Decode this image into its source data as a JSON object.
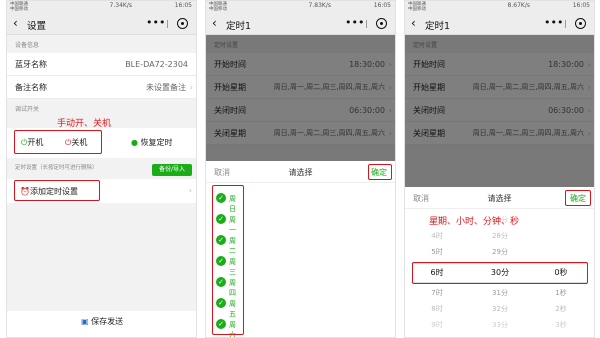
{
  "phone1": {
    "status": {
      "carrier1": "中国联通",
      "carrier2": "中国移动",
      "speed": "7.34K/s",
      "time": "16:05"
    },
    "title": "设置",
    "section_device": "设备信息",
    "rows": [
      {
        "label": "蓝牙名称",
        "value": "BLE-DA72-2304"
      },
      {
        "label": "备注名称",
        "value": "未设置备注"
      }
    ],
    "section_debug": "调试开关",
    "annotation": "手动开、关机",
    "btn_on": "开机",
    "btn_off": "关机",
    "btn_restore": "恢复定时",
    "section_timer": "定时设置（长按定时可进行删除）",
    "btn_backup": "备份/导入",
    "btn_add": "添加定时设置",
    "btn_save": "保存发送"
  },
  "phone2": {
    "status": {
      "carrier1": "中国联通",
      "carrier2": "中国移动",
      "speed": "7.83K/s",
      "time": "16:05"
    },
    "title": "定时1",
    "section": "定时设置",
    "rows": [
      {
        "label": "开始时间",
        "value": "18:30:00"
      },
      {
        "label": "开始星期",
        "value": "周日,周一,周二,周三,周四,周五,周六"
      },
      {
        "label": "关闭时间",
        "value": "06:30:00"
      },
      {
        "label": "关闭星期",
        "value": "周日,周一,周二,周三,周四,周五,周六"
      }
    ],
    "cancel": "取消",
    "prompt": "请选择",
    "ok": "确定",
    "days": [
      "周日",
      "周一",
      "周二",
      "周三",
      "周四",
      "周五",
      "周六"
    ]
  },
  "phone3": {
    "status": {
      "carrier1": "中国联通",
      "carrier2": "中国移动",
      "speed": "8.67K/s",
      "time": "16:05"
    },
    "title": "定时1",
    "section": "定时设置",
    "rows": [
      {
        "label": "开始时间",
        "value": "18:30:00"
      },
      {
        "label": "开始星期",
        "value": "周日,周一,周二,周三,周四,周五,周六"
      },
      {
        "label": "关闭时间",
        "value": "06:30:00"
      },
      {
        "label": "关闭星期",
        "value": "周日,周一,周二,周三,周四,周五,周六"
      }
    ],
    "cancel": "取消",
    "prompt": "请选择",
    "ok": "确定",
    "annotation": "星期、小时、分钟、秒",
    "hours": [
      "3时",
      "4时",
      "5时",
      "6时",
      "7时",
      "8时",
      "9时"
    ],
    "minutes": [
      "27分",
      "28分",
      "29分",
      "30分",
      "31分",
      "32分",
      "33分"
    ],
    "seconds": [
      "0秒",
      "1秒",
      "2秒",
      "3秒"
    ]
  },
  "colors": {
    "accent": "#1aad19",
    "annotation": "#e0161c"
  }
}
